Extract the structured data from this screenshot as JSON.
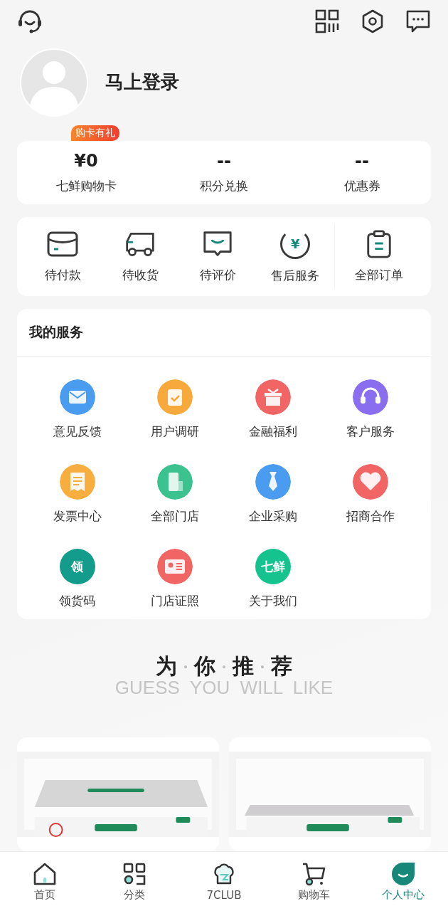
{
  "profile": {
    "login_text": "马上登录"
  },
  "assets": [
    {
      "value": "¥0",
      "label": "七鲜购物卡",
      "badge": "购卡有礼"
    },
    {
      "value": "--",
      "label": "积分兑换"
    },
    {
      "value": "--",
      "label": "优惠券"
    }
  ],
  "orders": [
    {
      "kind": "payment",
      "label": "待付款"
    },
    {
      "kind": "shipping",
      "label": "待收货"
    },
    {
      "kind": "review",
      "label": "待评价"
    },
    {
      "kind": "refund",
      "label": "售后服务",
      "icon_text": "¥"
    },
    {
      "kind": "all",
      "label": "全部订单"
    }
  ],
  "services": {
    "title": "我的服务",
    "items": [
      {
        "kind": "mail",
        "label": "意见反馈",
        "color": "#4a9cf0"
      },
      {
        "kind": "clipboard",
        "label": "用户调研",
        "color": "#f7a93c"
      },
      {
        "kind": "gift",
        "label": "金融福利",
        "color": "#f26565"
      },
      {
        "kind": "headset",
        "label": "客户服务",
        "color": "#8a6ef0"
      },
      {
        "kind": "receipt",
        "label": "发票中心",
        "color": "#f8ad3f"
      },
      {
        "kind": "building",
        "label": "全部门店",
        "color": "#3cc28f"
      },
      {
        "kind": "tie",
        "label": "企业采购",
        "color": "#4a9cf0"
      },
      {
        "kind": "heart",
        "label": "招商合作",
        "color": "#f26565"
      },
      {
        "kind": "glyph",
        "label": "领货码",
        "color": "#139c8c",
        "icon_text": "领"
      },
      {
        "kind": "license",
        "label": "门店证照",
        "color": "#f26565"
      },
      {
        "kind": "glyph",
        "label": "关于我们",
        "color": "#14c38e",
        "icon_text": "七鲜"
      }
    ]
  },
  "recommend": {
    "title": [
      "为",
      "你",
      "推",
      "荐"
    ],
    "subtitle": "GUESS  YOU  WILL  LIKE",
    "products": [
      {
        "kind": "picture"
      },
      {
        "kind": "picture"
      }
    ]
  },
  "tab_bar": [
    {
      "kind": "home",
      "label": "首页",
      "selected": false
    },
    {
      "kind": "category",
      "label": "分类",
      "selected": false
    },
    {
      "kind": "club",
      "label": "7CLUB",
      "selected": false
    },
    {
      "kind": "cart",
      "label": "购物车",
      "selected": false
    },
    {
      "kind": "me",
      "label": "个人中心",
      "selected": true
    }
  ]
}
